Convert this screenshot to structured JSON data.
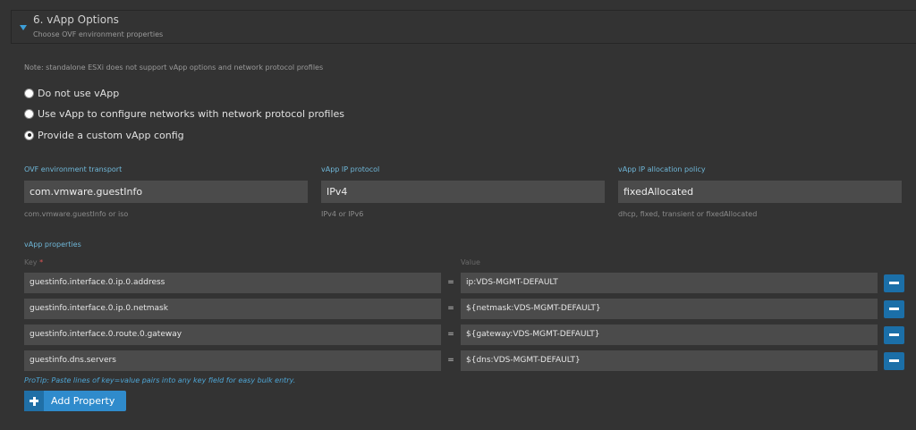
{
  "section": {
    "title": "6. vApp Options",
    "subtitle": "Choose OVF environment properties"
  },
  "note": "Note: standalone ESXi does not support vApp options and network protocol profiles",
  "vapp_mode": {
    "options": [
      {
        "label": "Do not use vApp",
        "checked": false
      },
      {
        "label": "Use vApp to configure networks with network protocol profiles",
        "checked": false
      },
      {
        "label": "Provide a custom vApp config",
        "checked": true
      }
    ]
  },
  "fields": {
    "transport": {
      "label": "OVF environment transport",
      "value": "com.vmware.guestInfo",
      "help": "com.vmware.guestInfo or iso"
    },
    "ip_protocol": {
      "label": "vApp IP protocol",
      "value": "IPv4",
      "help": "IPv4 or IPv6"
    },
    "ip_allocation": {
      "label": "vApp IP allocation policy",
      "value": "fixedAllocated",
      "help": "dhcp, fixed, transient or fixedAllocated"
    }
  },
  "properties": {
    "title": "vApp properties",
    "key_header": "Key",
    "required_mark": "*",
    "value_header": "Value",
    "equals": "=",
    "rows": [
      {
        "key": "guestinfo.interface.0.ip.0.address",
        "value": "ip:VDS-MGMT-DEFAULT"
      },
      {
        "key": "guestinfo.interface.0.ip.0.netmask",
        "value": "${netmask:VDS-MGMT-DEFAULT}"
      },
      {
        "key": "guestinfo.interface.0.route.0.gateway",
        "value": "${gateway:VDS-MGMT-DEFAULT}"
      },
      {
        "key": "guestinfo.dns.servers",
        "value": "${dns:VDS-MGMT-DEFAULT}"
      }
    ],
    "protip": "ProTip: Paste lines of key=value pairs into any key field for easy bulk entry.",
    "add_button_label": "Add Property"
  },
  "colors": {
    "background": "#333333",
    "accent_label": "#6fb7d8",
    "button_blue": "#2f8bcc",
    "remove_blue": "#1b6fa8"
  }
}
